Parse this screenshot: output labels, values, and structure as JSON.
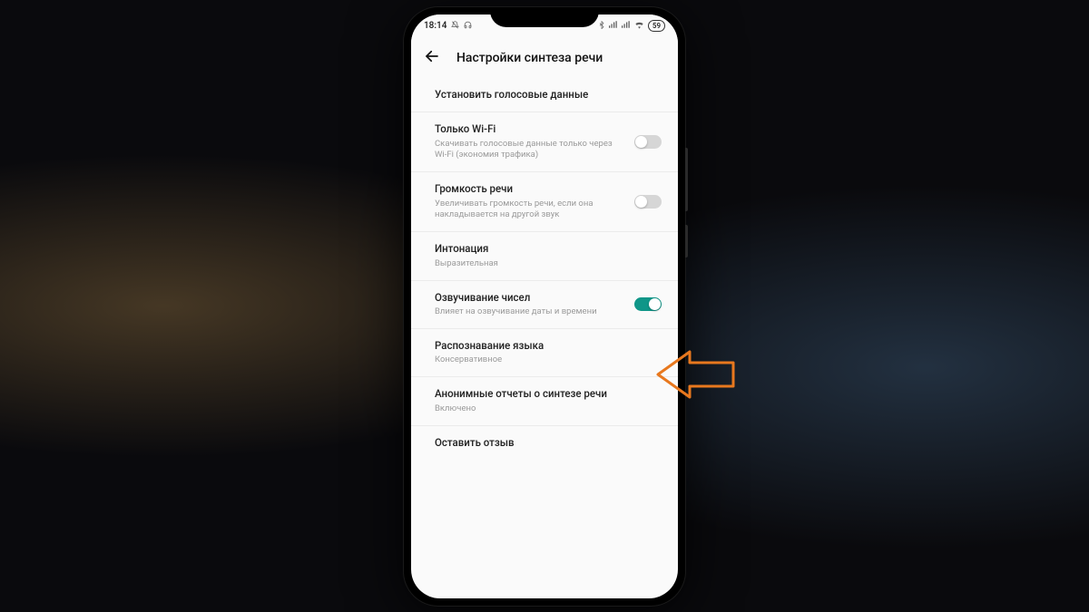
{
  "status": {
    "time": "18:14",
    "battery_text": "59"
  },
  "header": {
    "title": "Настройки синтеза речи"
  },
  "settings": [
    {
      "title": "Установить голосовые данные",
      "subtitle": "",
      "toggle": null
    },
    {
      "title": "Только Wi-Fi",
      "subtitle": "Скачивать голосовые данные только через Wi-Fi (экономия трафика)",
      "toggle": "off"
    },
    {
      "title": "Громкость речи",
      "subtitle": "Увеличивать громкость речи, если она накладывается на другой звук",
      "toggle": "off"
    },
    {
      "title": "Интонация",
      "subtitle": "Выразительная",
      "toggle": null
    },
    {
      "title": "Озвучивание чисел",
      "subtitle": "Влияет на озвучивание даты и времени",
      "toggle": "on"
    },
    {
      "title": "Распознавание языка",
      "subtitle": "Консервативное",
      "toggle": null
    },
    {
      "title": "Анонимные отчеты о синтезе речи",
      "subtitle": "Включено",
      "toggle": null
    },
    {
      "title": "Оставить отзыв",
      "subtitle": "",
      "toggle": null
    }
  ],
  "annotation": {
    "arrow_color": "#e8781e"
  }
}
